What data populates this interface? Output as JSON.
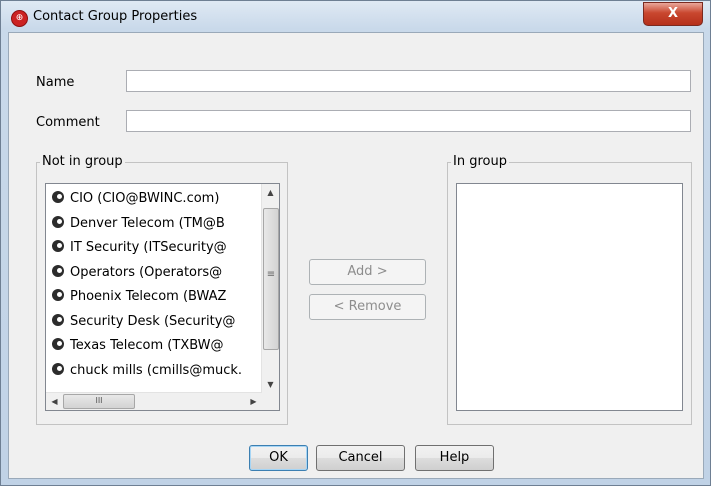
{
  "window": {
    "title": "Contact Group Properties",
    "app_icon": "globe-icon",
    "close_label": "X"
  },
  "form": {
    "name_label": "Name",
    "name_value": "",
    "comment_label": "Comment",
    "comment_value": ""
  },
  "not_in_group": {
    "title": "Not in group",
    "items": [
      "CIO (CIO@BWINC.com)",
      "Denver Telecom  (TM@B",
      "IT Security (ITSecurity@",
      "Operators (Operators@",
      "Phoenix Telecom (BWAZ",
      "Security Desk (Security@",
      "Texas Telecom (TXBW@",
      "chuck mills (cmills@muck."
    ]
  },
  "in_group": {
    "title": "In group",
    "items": []
  },
  "actions": {
    "add_label": "Add >",
    "remove_label": "< Remove"
  },
  "footer": {
    "ok_label": "OK",
    "cancel_label": "Cancel",
    "help_label": "Help"
  },
  "scrollbar": {
    "up_arrow": "▲",
    "down_arrow": "▼",
    "left_arrow": "◀",
    "right_arrow": "▶",
    "thumb_grip": "≡",
    "hthumb_grip": "III"
  }
}
